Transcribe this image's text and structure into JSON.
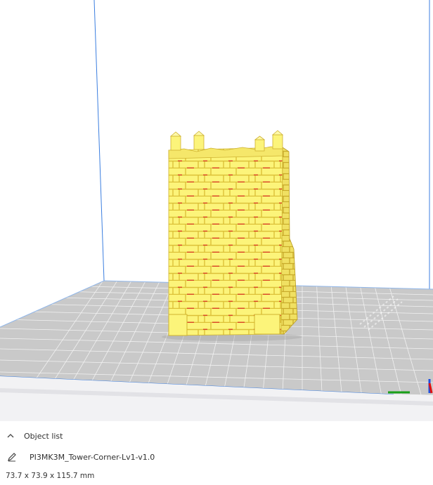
{
  "app": {
    "colors": {
      "canvas_background": "#ffffff",
      "build_volume_edge": "#3b7ee0",
      "bed_fill": "#c9c9c9",
      "bed_grid": "#ffffff",
      "model_yellow": "#fcf47a",
      "model_shadow": "#ecd44a",
      "overhang_red": "#d82020",
      "axis_x": "#e01010",
      "axis_y": "#19a019",
      "axis_z": "#1f4fe0"
    }
  },
  "viewport": {
    "model_icon": "tower-model",
    "axes_icon": "xyz-axes-indicator"
  },
  "object_list": {
    "toggle_icon": "chevron-up-icon",
    "label": "Object list"
  },
  "object": {
    "edit_icon": "pencil-icon",
    "name": "PI3MK3M_Tower-Corner-Lv1-v1.0",
    "dimensions": "73.7 x 73.9 x 115.7 mm"
  }
}
